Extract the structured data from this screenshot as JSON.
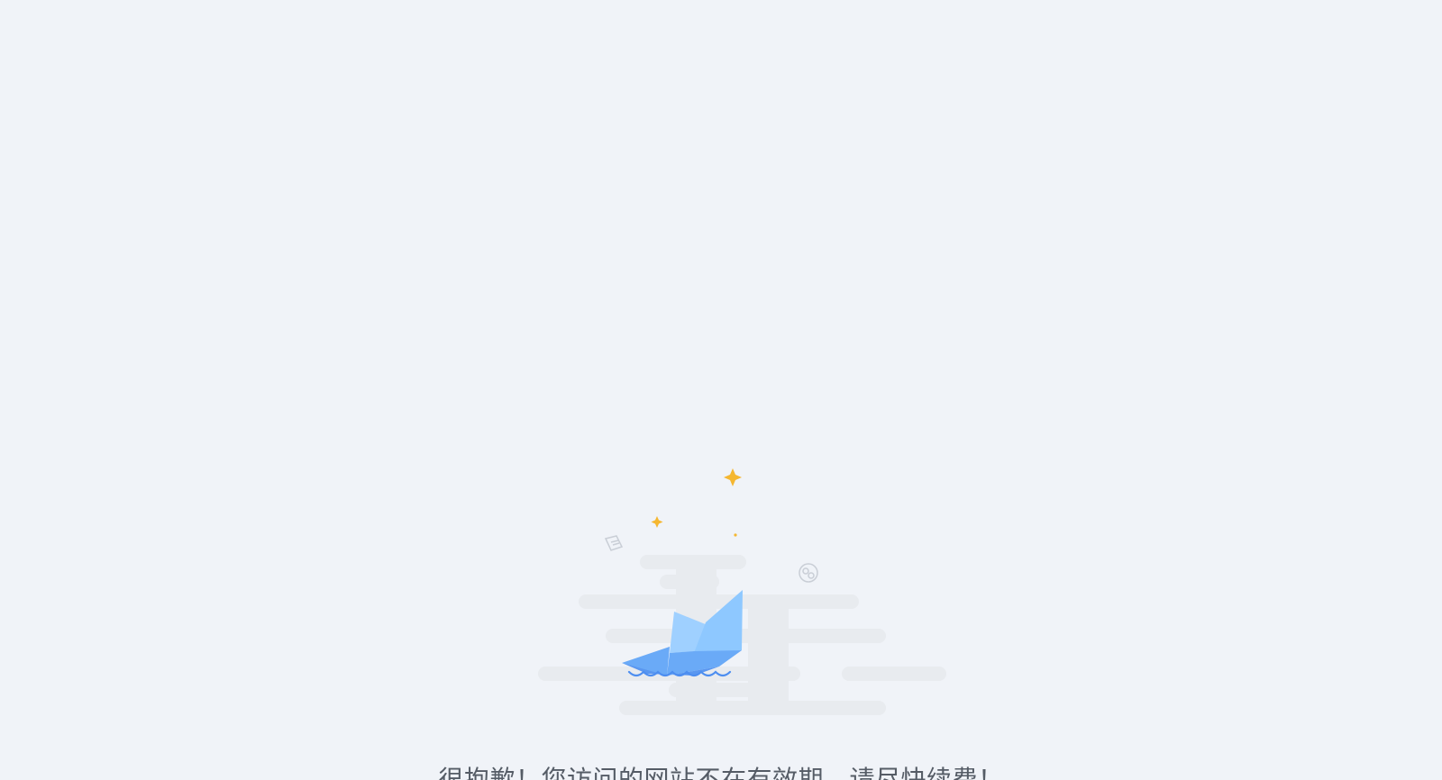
{
  "notice": {
    "message": "很抱歉！您访问的网站不在有效期，请尽快续费！"
  },
  "illustration": {
    "subject": "paper-boat-on-water",
    "colors": {
      "boat_light": "#8ec8ff",
      "boat_mid": "#6aaaf7",
      "boat_dark": "#5a97f0",
      "wave": "#4d8ef0",
      "sparkle": "#f5b731",
      "cloud": "#e8ebef",
      "outline": "#c9ced6"
    }
  }
}
